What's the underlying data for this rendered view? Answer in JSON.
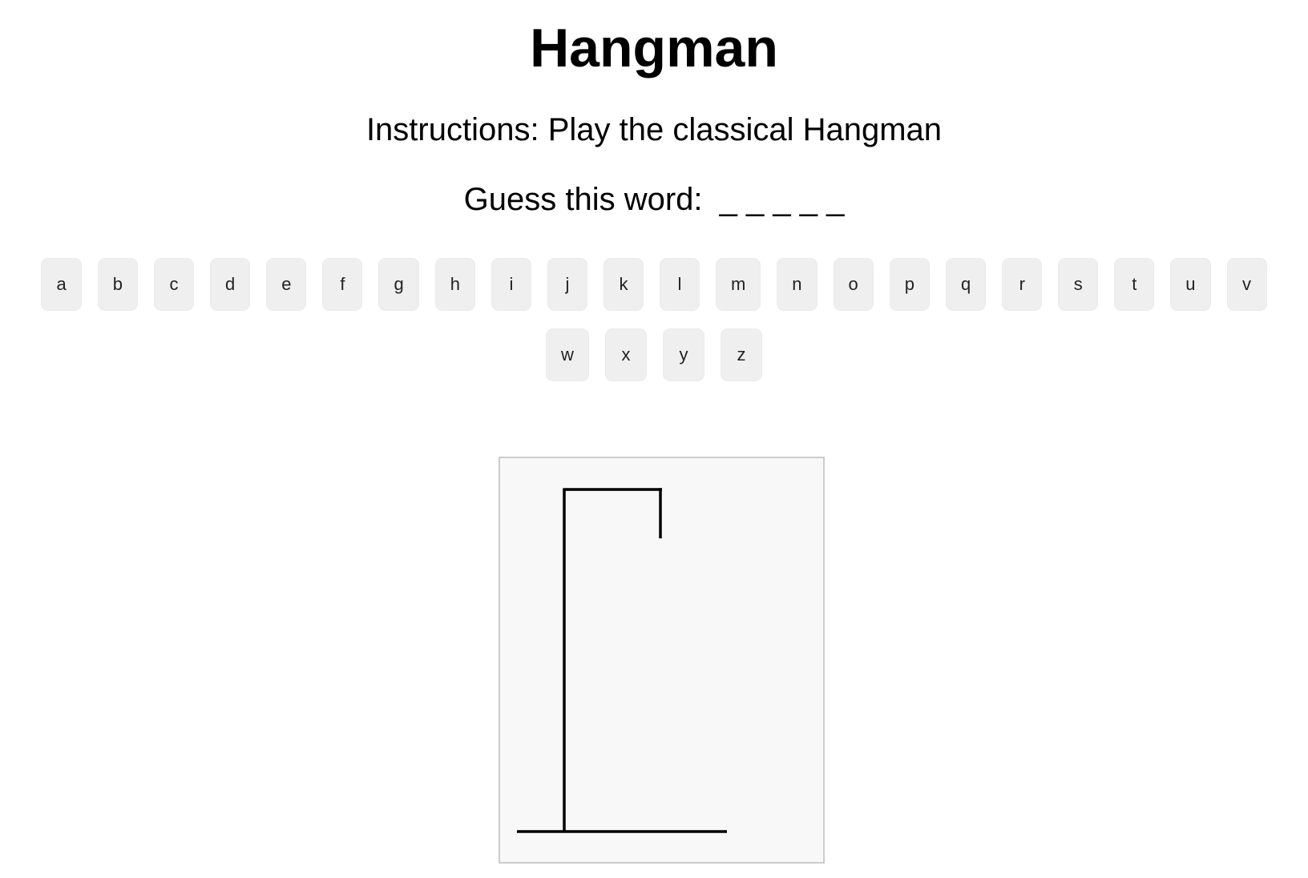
{
  "title": "Hangman",
  "instructions": "Instructions: Play the classical Hangman",
  "guess": {
    "label": "Guess this word:",
    "masked_word": "_ _ _ _ _"
  },
  "keyboard": {
    "row1": [
      "a",
      "b",
      "c",
      "d",
      "e",
      "f",
      "g",
      "h",
      "i",
      "j",
      "k",
      "l",
      "m",
      "n",
      "o",
      "p",
      "q",
      "r",
      "s",
      "t",
      "u",
      "v"
    ],
    "row2": [
      "w",
      "x",
      "y",
      "z"
    ]
  },
  "gallows": {
    "stroke_color": "#000000",
    "board_background": "#f8f8f8",
    "board_border": "#cccccc",
    "parts_shown": [
      "base",
      "pole",
      "beam",
      "rope"
    ]
  }
}
